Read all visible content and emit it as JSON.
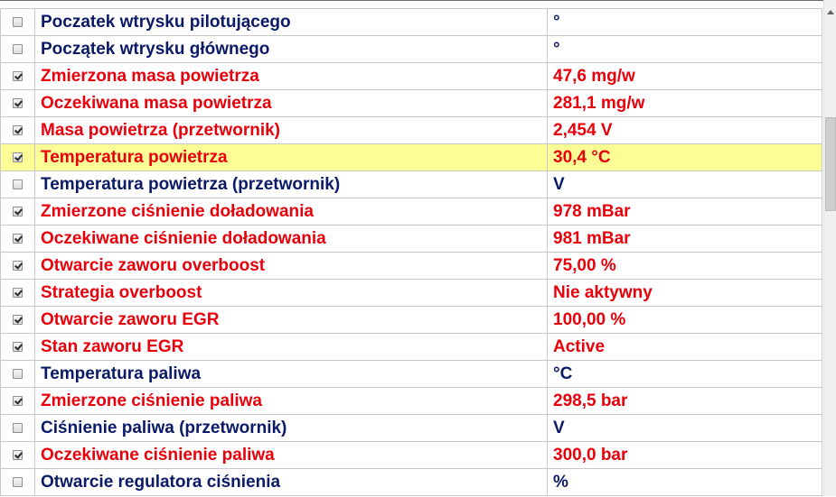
{
  "parameters": [
    {
      "label": "Poczatek wtrysku pilotującego",
      "value": "°",
      "checked": false
    },
    {
      "label": "Początek wtrysku głównego",
      "value": "°",
      "checked": false
    },
    {
      "label": "Zmierzona masa powietrza",
      "value": "47,6 mg/w",
      "checked": true
    },
    {
      "label": "Oczekiwana masa powietrza",
      "value": "281,1 mg/w",
      "checked": true
    },
    {
      "label": "Masa powietrza (przetwornik)",
      "value": "2,454 V",
      "checked": true
    },
    {
      "label": "Temperatura powietrza",
      "value": "30,4 °C",
      "checked": true,
      "highlighted": true
    },
    {
      "label": "Temperatura powietrza (przetwornik)",
      "value": " V",
      "checked": false
    },
    {
      "label": "Zmierzone ciśnienie doładowania",
      "value": "978 mBar",
      "checked": true
    },
    {
      "label": "Oczekiwane ciśnienie doładowania",
      "value": "981 mBar",
      "checked": true
    },
    {
      "label": "Otwarcie zaworu overboost",
      "value": "75,00 %",
      "checked": true
    },
    {
      "label": "Strategia overboost",
      "value": "Nie aktywny",
      "checked": true
    },
    {
      "label": "Otwarcie zaworu EGR",
      "value": "100,00 %",
      "checked": true
    },
    {
      "label": "Stan zaworu EGR",
      "value": "Active",
      "checked": true
    },
    {
      "label": "Temperatura paliwa",
      "value": " °C",
      "checked": false
    },
    {
      "label": "Zmierzone ciśnienie paliwa",
      "value": "298,5 bar",
      "checked": true
    },
    {
      "label": "Ciśnienie paliwa (przetwornik)",
      "value": " V",
      "checked": false
    },
    {
      "label": "Oczekiwane ciśnienie paliwa",
      "value": "300,0 bar",
      "checked": true
    },
    {
      "label": "Otwarcie regulatora ciśnienia",
      "value": " %",
      "checked": false
    }
  ],
  "colors": {
    "active_text": "#e8000b",
    "inactive_text": "#0a1a66",
    "highlight_row": "#fdfd96",
    "grid_line": "#c8c8c8"
  },
  "scrollbar": {
    "up_arrow_icon": "triangle-up-icon"
  }
}
